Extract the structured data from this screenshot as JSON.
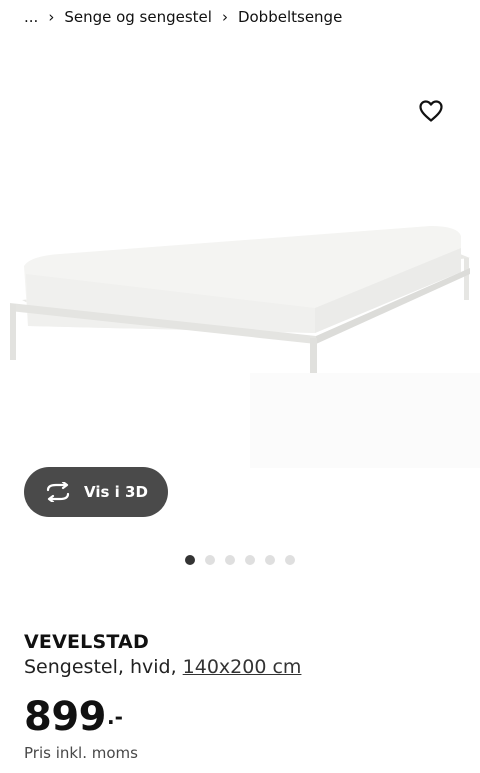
{
  "breadcrumb": {
    "ellipsis": "...",
    "items": [
      "Senge og sengestel",
      "Dobbeltsenge"
    ],
    "separator": "›"
  },
  "gallery": {
    "favorite_icon": "heart-outline-icon",
    "view3d_icon": "rotate-3d-icon",
    "view3d_label": "Vis i 3D",
    "dots_total": 6,
    "dots_active_index": 0
  },
  "product": {
    "name": "VEVELSTAD",
    "description": "Sengestel, hvid,",
    "size": "140x200 cm",
    "price_integer": "899",
    "price_suffix": ".-",
    "price_note": "Pris inkl. moms"
  },
  "colors": {
    "button_bg": "#4a4a4a",
    "dot_active": "#333333",
    "dot_inactive": "#dfdfdf"
  }
}
